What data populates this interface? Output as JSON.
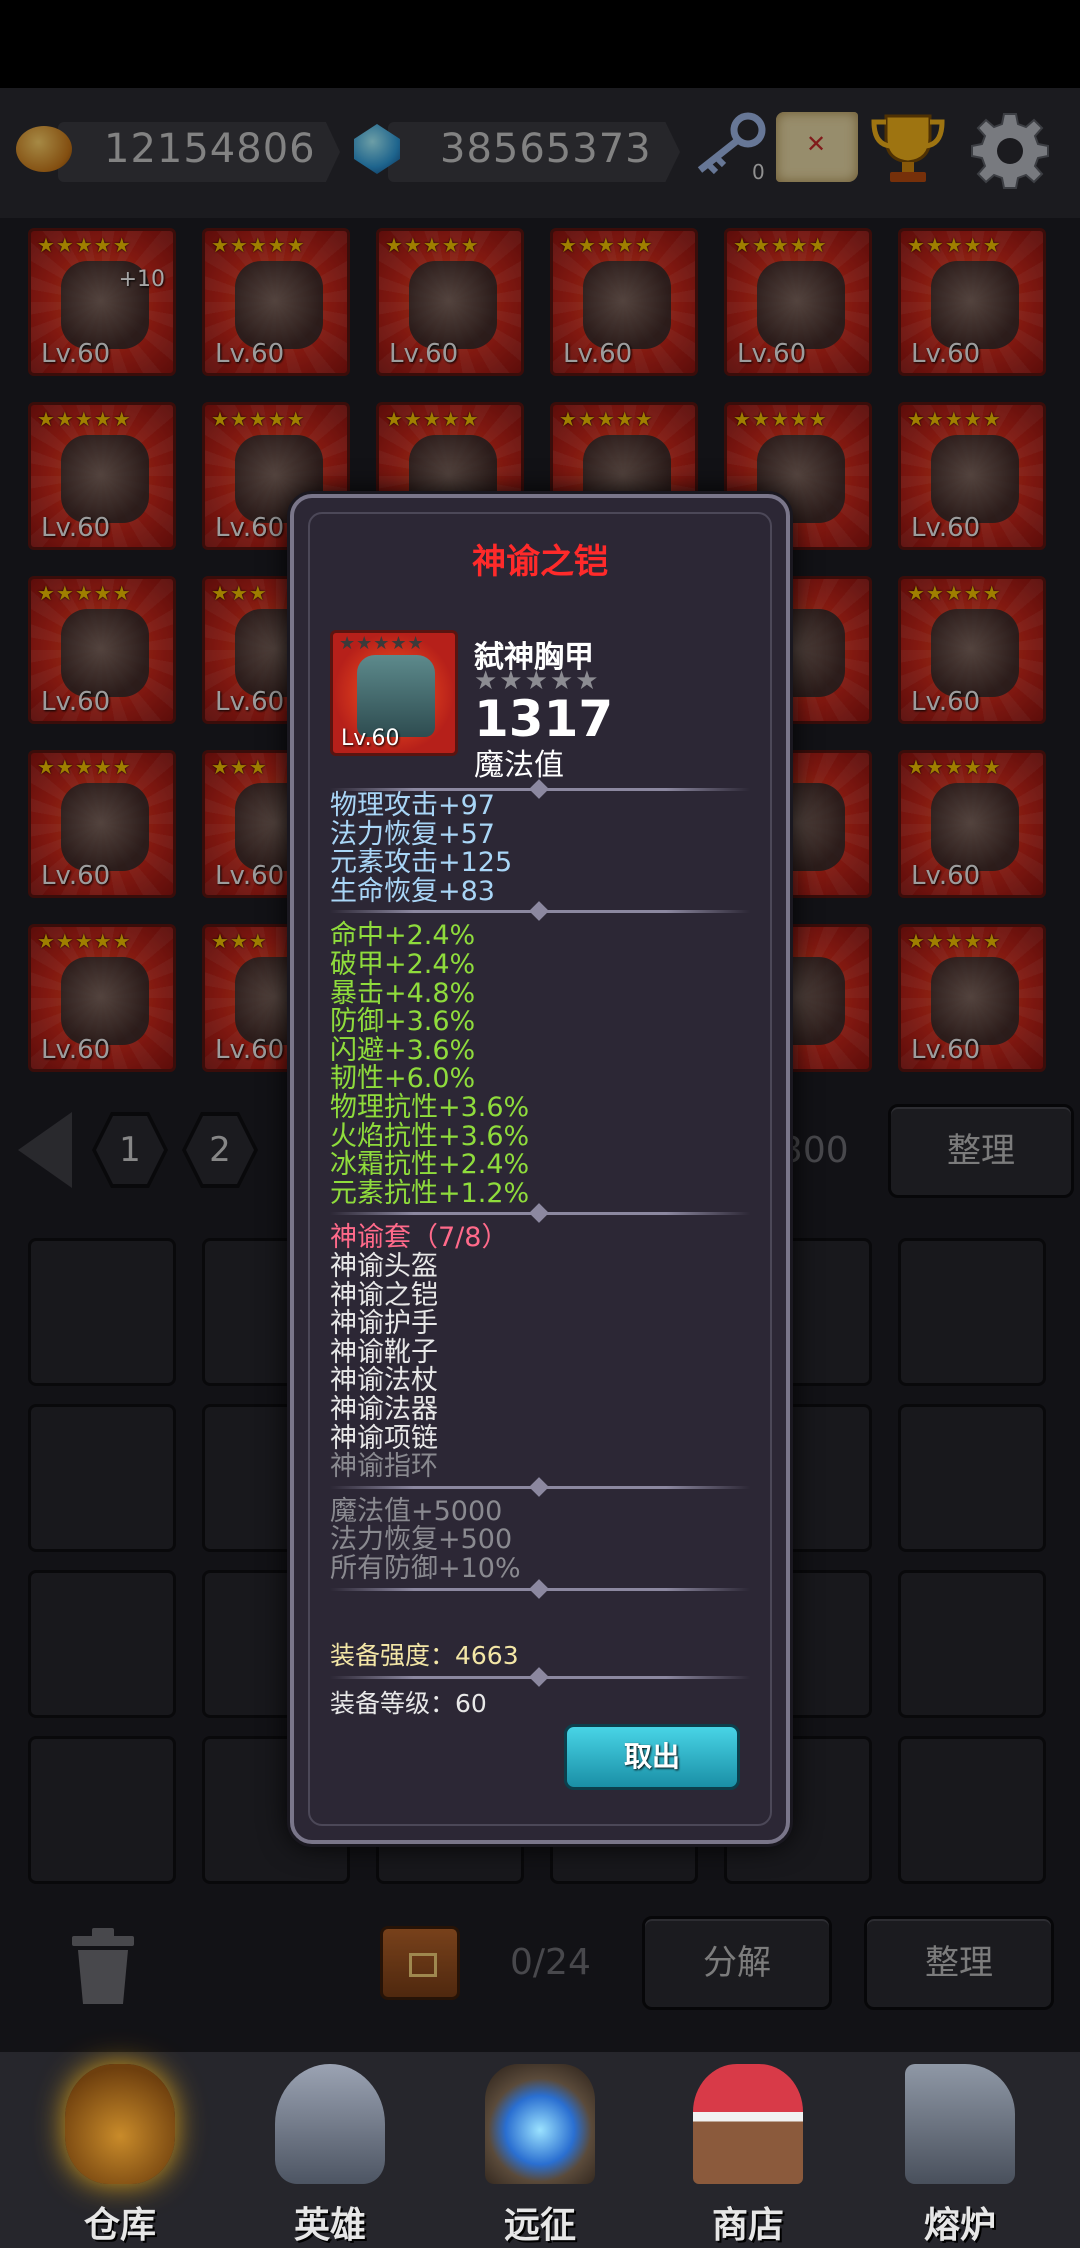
{
  "resources": {
    "gold": "12154806",
    "gems": "38565373",
    "key_count": "0"
  },
  "grid": {
    "rows": [
      [
        {
          "stars": "★★★★★",
          "level": "Lv.60",
          "plus": "+10"
        },
        {
          "stars": "★★★★★",
          "level": "Lv.60"
        },
        {
          "stars": "★★★★★",
          "level": "Lv.60"
        },
        {
          "stars": "★★★★★",
          "level": "Lv.60"
        },
        {
          "stars": "★★★★★",
          "level": "Lv.60"
        },
        {
          "stars": "★★★★★",
          "level": "Lv.60"
        }
      ],
      [
        {
          "stars": "★★★★★",
          "level": "Lv.60"
        },
        {
          "stars": "★★★★★",
          "level": "Lv.60"
        },
        {
          "stars": "★★★★★",
          "level": ""
        },
        {
          "stars": "★★★★★",
          "level": ""
        },
        {
          "stars": "★★★★★",
          "level": "0"
        },
        {
          "stars": "★★★★★",
          "level": "Lv.60"
        }
      ],
      [
        {
          "stars": "★★★★★",
          "level": "Lv.60"
        },
        {
          "stars": "★★★",
          "level": "Lv.60"
        },
        {
          "stars": "",
          "level": ""
        },
        {
          "stars": "",
          "level": ""
        },
        {
          "stars": "★★★",
          "level": "0"
        },
        {
          "stars": "★★★★★",
          "level": "Lv.60"
        }
      ],
      [
        {
          "stars": "★★★★★",
          "level": "Lv.60"
        },
        {
          "stars": "★★★",
          "level": "Lv.60"
        },
        {
          "stars": "",
          "level": ""
        },
        {
          "stars": "",
          "level": ""
        },
        {
          "stars": "",
          "level": "0"
        },
        {
          "stars": "★★★★★",
          "level": "Lv.60"
        }
      ],
      [
        {
          "stars": "★★★★★",
          "level": "Lv.60"
        },
        {
          "stars": "★★★",
          "level": "Lv.60"
        },
        {
          "stars": "",
          "level": ""
        },
        {
          "stars": "",
          "level": ""
        },
        {
          "stars": "★★★",
          "level": "0"
        },
        {
          "stars": "★★★★★",
          "level": "Lv.60"
        }
      ]
    ]
  },
  "pagination": {
    "pages": [
      "1",
      "2"
    ],
    "capacity": "300",
    "sort_label": "整理"
  },
  "bag": {
    "count": "0/24",
    "disassemble_label": "分解",
    "sort_label": "整理"
  },
  "nav": {
    "items": [
      {
        "label": "仓库"
      },
      {
        "label": "英雄"
      },
      {
        "label": "远征"
      },
      {
        "label": "商店"
      },
      {
        "label": "熔炉"
      }
    ]
  },
  "modal": {
    "title": "神谕之铠",
    "item": {
      "level": "Lv.60",
      "name": "弑神胸甲",
      "stars": "★★★★★",
      "value": "1317",
      "value_label": "魔法值"
    },
    "base_stats": [
      "物理攻击+97",
      "法力恢复+57",
      "元素攻击+125",
      "生命恢复+83"
    ],
    "bonus_stats": [
      "命中+2.4%",
      "破甲+2.4%",
      "暴击+4.8%",
      "防御+3.6%",
      "闪避+3.6%",
      "韧性+6.0%",
      "物理抗性+3.6%",
      "火焰抗性+3.6%",
      "冰霜抗性+2.4%",
      "元素抗性+1.2%"
    ],
    "set": {
      "title": "神谕套（7/8）",
      "pieces_owned": [
        "神谕头盔",
        "神谕之铠",
        "神谕护手",
        "神谕靴子",
        "神谕法杖",
        "神谕法器",
        "神谕项链"
      ],
      "pieces_missing": [
        "神谕指环"
      ],
      "bonuses": [
        "魔法值+5000",
        "法力恢复+500",
        "所有防御+10%"
      ]
    },
    "power": "装备强度：4663",
    "level_line": "装备等级：60",
    "take_out_label": "取出"
  },
  "colors": {
    "title_red": "#ff2a2a",
    "stat_blue": "#a9d6f7",
    "stat_green": "#8fdc3c",
    "set_pink": "#ff6a8a",
    "button_cyan": "#2bb6cf"
  }
}
